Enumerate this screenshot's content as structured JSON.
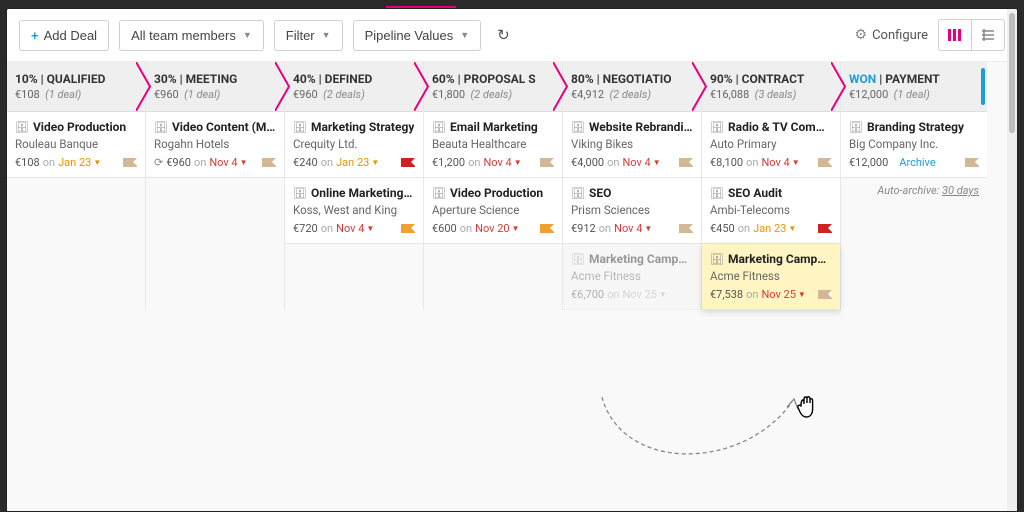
{
  "toolbar": {
    "add_deal": "Add Deal",
    "team_filter": "All team members",
    "filter": "Filter",
    "pipeline_values": "Pipeline Values",
    "configure": "Configure"
  },
  "auto_archive": {
    "prefix": "Auto-archive: ",
    "days": "30 days"
  },
  "stages": [
    {
      "pct": "10%",
      "name": "QUALIFIED",
      "total": "€108",
      "count": "(1 deal)"
    },
    {
      "pct": "30%",
      "name": "MEETING",
      "total": "€960",
      "count": "(1 deal)"
    },
    {
      "pct": "40%",
      "name": "DEFINED",
      "total": "€960",
      "count": "(2 deals)"
    },
    {
      "pct": "60%",
      "name": "PROPOSAL S",
      "total": "€1,800",
      "count": "(2 deals)"
    },
    {
      "pct": "80%",
      "name": "NEGOTIATIO",
      "total": "€4,912",
      "count": "(2 deals)"
    },
    {
      "pct": "90%",
      "name": "CONTRACT",
      "total": "€16,088",
      "count": "(3 deals)"
    },
    {
      "won": "WON",
      "name": "PAYMENT",
      "total": "€12,000",
      "count": "(1 deal)"
    }
  ],
  "cards": {
    "c0_0": {
      "title": "Video Production",
      "company": "Rouleau Banque",
      "price": "€108",
      "date": "Jan 23",
      "date_color": "orange",
      "flag": "tan"
    },
    "c1_0": {
      "title": "Video Content (M...",
      "company": "Rogahn Hotels",
      "price": "€960",
      "date": "Nov 4",
      "date_color": "red",
      "flag": "tan",
      "cycle": true
    },
    "c2_0": {
      "title": "Marketing Strategy",
      "company": "Crequity Ltd.",
      "price": "€240",
      "date": "Jan 23",
      "date_color": "orange",
      "flag": "dark"
    },
    "c2_1": {
      "title": "Online Marketing ...",
      "company": "Koss, West and King",
      "price": "€720",
      "date": "Nov 4",
      "date_color": "red",
      "flag": "orange"
    },
    "c3_0": {
      "title": "Email Marketing",
      "company": "Beauta Healthcare",
      "price": "€1,200",
      "date": "Nov 4",
      "date_color": "red",
      "flag": "tan"
    },
    "c3_1": {
      "title": "Video Production",
      "company": "Aperture Science",
      "price": "€600",
      "date": "Nov 20",
      "date_color": "red",
      "flag": "orange"
    },
    "c4_0": {
      "title": "Website Rebrandi...",
      "company": "Viking Bikes",
      "price": "€4,000",
      "date": "Nov 4",
      "date_color": "red",
      "flag": "tan"
    },
    "c4_1": {
      "title": "SEO",
      "company": "Prism Sciences",
      "price": "€912",
      "date": "Nov 4",
      "date_color": "red",
      "flag": "tan"
    },
    "c4_2_ghost": {
      "title": "Marketing Campa...",
      "company": "Acme Fitness",
      "price": "€6,700",
      "date": "Nov 25"
    },
    "c5_0": {
      "title": "Radio & TV Comm...",
      "company": "Auto Primary",
      "price": "€8,100",
      "date": "Nov 4",
      "date_color": "red",
      "flag": "tan"
    },
    "c5_1": {
      "title": "SEO Audit",
      "company": "Ambi-Telecoms",
      "price": "€450",
      "date": "Jan 23",
      "date_color": "orange",
      "flag": "dark"
    },
    "c5_2_drag": {
      "title": "Marketing Campa...",
      "company": "Acme Fitness",
      "price": "€7,538",
      "date": "Nov 25",
      "date_color": "red",
      "flag": "tan"
    },
    "c6_0": {
      "title": "Branding Strategy",
      "company": "Big Company Inc.",
      "price": "€12,000",
      "archive": "Archive",
      "flag": "tan"
    }
  },
  "labels": {
    "on": "on"
  }
}
